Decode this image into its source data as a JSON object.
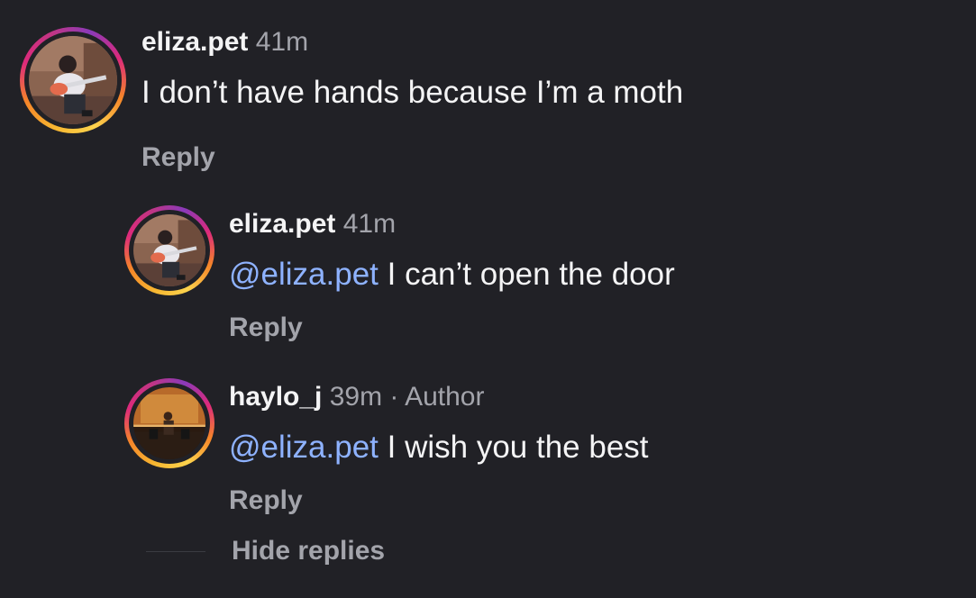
{
  "comments": [
    {
      "username": "eliza.pet",
      "time": "41m",
      "text": "I don’t have hands because I’m a moth",
      "reply_label": "Reply"
    },
    {
      "username": "eliza.pet",
      "time": "41m",
      "mention": "@eliza.pet",
      "text": " I can’t open the door",
      "reply_label": "Reply"
    },
    {
      "username": "haylo_j",
      "time": "39m",
      "separator": " · ",
      "author_tag": "Author",
      "mention": "@eliza.pet",
      "text": " I wish you the best",
      "reply_label": "Reply"
    }
  ],
  "hide_replies_label": "Hide replies",
  "colors": {
    "background": "#212126",
    "username": "#f4f4f5",
    "meta": "#a3a4ab",
    "mention": "#8eb2ff"
  }
}
